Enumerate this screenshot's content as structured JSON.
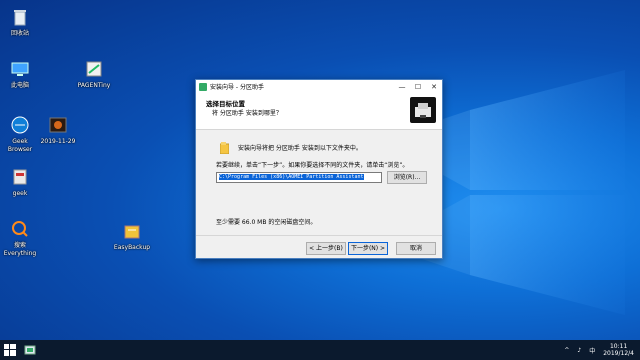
{
  "desktop": {
    "icons": [
      {
        "label": "回收站",
        "icon": "recycle-bin-icon"
      },
      {
        "label": "此电脑",
        "icon": "computer-icon"
      },
      {
        "label": "PAGENTiny",
        "icon": "app-icon"
      },
      {
        "label": "Geek\nBrowser",
        "icon": "browser-icon"
      },
      {
        "label": "2019-11-29",
        "icon": "image-icon"
      },
      {
        "label": "geek",
        "icon": "app-icon"
      },
      {
        "label": "搜索\nEverything",
        "icon": "search-icon"
      },
      {
        "label": "EasyBackup",
        "icon": "backup-icon"
      }
    ]
  },
  "window": {
    "title": "安装向导 - 分区助手",
    "header_title": "选择目标位置",
    "header_subtitle": "将 分区助手 安装到哪里？",
    "install_text": "安装向导将把 分区助手 安装到以下文件夹中。",
    "instruction": "若要继续，单击“下一步”。如果你要选择不同的文件夹，请单击“浏览”。",
    "path_value": "C:\\Program Files (x86)\\AOMEI Partition Assistant",
    "browse_label": "浏览(R)...",
    "space_text": "至少需要 66.0 MB 的空闲磁盘空间。",
    "back_label": "< 上一步(B)",
    "next_label": "下一步(N) >",
    "cancel_label": "取消"
  },
  "taskbar": {
    "tray_symbols": [
      "^",
      "♪",
      "中"
    ],
    "time": "10:11",
    "date": "2019/12/4"
  },
  "colors": {
    "accent": "#0a64d8",
    "desktop_bg": "#0a4fb3",
    "taskbar_bg": "#0b1a2e"
  }
}
